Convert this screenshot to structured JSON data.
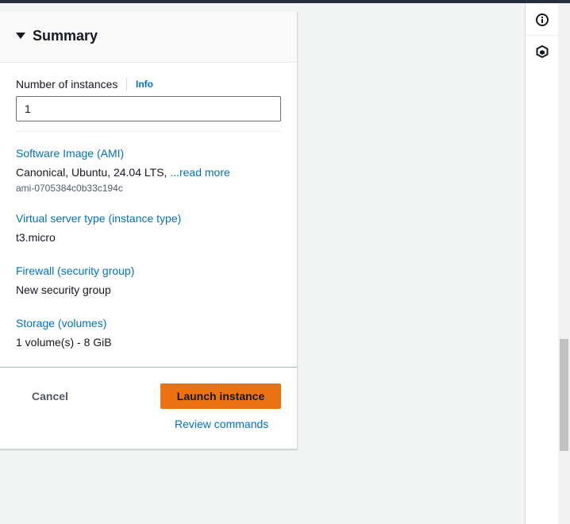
{
  "summary": {
    "title": "Summary",
    "instances_label": "Number of instances",
    "info_label": "Info",
    "instances_value": "1",
    "ami_label": "Software Image (AMI)",
    "ami_value": "Canonical, Ubuntu, 24.04 LTS, ",
    "ami_read_more": "...read more",
    "ami_id": "ami-0705384c0b33c194c",
    "instance_type_label": "Virtual server type (instance type)",
    "instance_type_value": "t3.micro",
    "firewall_label": "Firewall (security group)",
    "firewall_value": "New security group",
    "storage_label": "Storage (volumes)",
    "storage_value": "1 volume(s) - 8 GiB"
  },
  "actions": {
    "cancel_label": "Cancel",
    "launch_label": "Launch instance",
    "review_label": "Review commands"
  },
  "rail": {
    "icons": [
      "info-icon",
      "cube-icon"
    ]
  },
  "colors": {
    "link": "#0073bb",
    "primary_button": "#ec7211",
    "top_bar": "#232f3e"
  }
}
